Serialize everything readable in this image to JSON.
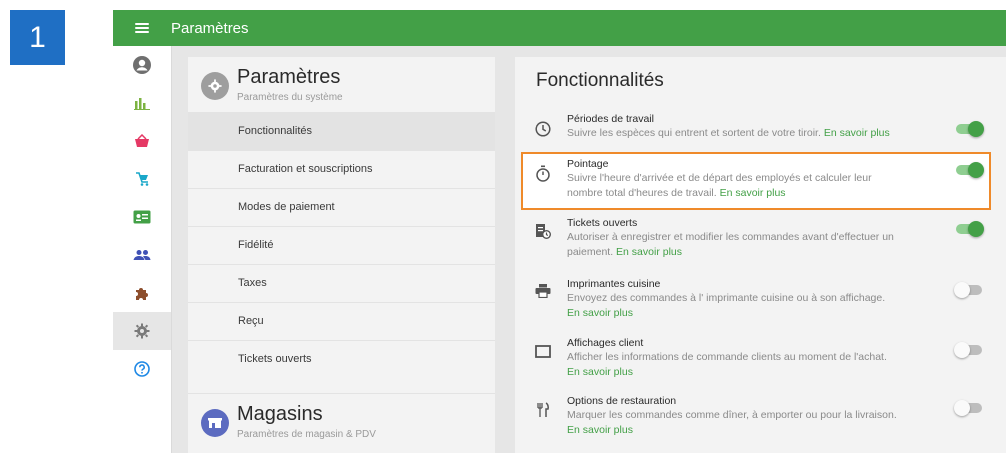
{
  "step_number": "1",
  "topbar": {
    "title": "Paramètres"
  },
  "sidenav": {
    "items": [
      {
        "icon": "account-icon"
      },
      {
        "icon": "bar-chart-icon"
      },
      {
        "icon": "basket-icon"
      },
      {
        "icon": "cart-icon"
      },
      {
        "icon": "id-card-icon"
      },
      {
        "icon": "people-icon"
      },
      {
        "icon": "puzzle-icon"
      },
      {
        "icon": "gear-icon",
        "active": true
      },
      {
        "icon": "help-icon"
      }
    ]
  },
  "settings_card": {
    "title": "Paramètres",
    "subtitle": "Paramètres du système",
    "items": [
      {
        "label": "Fonctionnalités",
        "active": true
      },
      {
        "label": "Facturation et souscriptions"
      },
      {
        "label": "Modes de paiement"
      },
      {
        "label": "Fidélité"
      },
      {
        "label": "Taxes"
      },
      {
        "label": "Reçu"
      },
      {
        "label": "Tickets ouverts"
      }
    ]
  },
  "stores_card": {
    "title": "Magasins",
    "subtitle": "Paramètres de magasin & PDV"
  },
  "features": {
    "title": "Fonctionnalités",
    "learn_more": "En savoir plus",
    "items": [
      {
        "icon": "clock-icon",
        "name": "Périodes de travail",
        "desc": "Suivre les espèces qui entrent et sortent de votre tiroir.",
        "enabled": true
      },
      {
        "icon": "stopwatch-icon",
        "name": "Pointage",
        "desc": "Suivre l'heure d'arrivée et de départ des employés et calculer leur nombre total d'heures de travail.",
        "enabled": true,
        "highlighted": true
      },
      {
        "icon": "open-tickets-icon",
        "name": "Tickets ouverts",
        "desc": "Autoriser à enregistrer et modifier les commandes avant d'effectuer un paiement.",
        "enabled": true
      },
      {
        "icon": "printer-icon",
        "name": "Imprimantes cuisine",
        "desc": "Envoyez des commandes à l' imprimante cuisine ou à son affichage.",
        "enabled": false
      },
      {
        "icon": "monitor-icon",
        "name": "Affichages client",
        "desc": "Afficher les informations de commande clients au moment de l'achat.",
        "enabled": false
      },
      {
        "icon": "cutlery-icon",
        "name": "Options de restauration",
        "desc": "Marquer les commandes comme dîner, à emporter ou pour la livraison.",
        "enabled": false
      }
    ]
  },
  "colors": {
    "brand_green": "#43a047",
    "highlight_orange": "#ef8a2a",
    "step_blue": "#1f6fc4"
  }
}
